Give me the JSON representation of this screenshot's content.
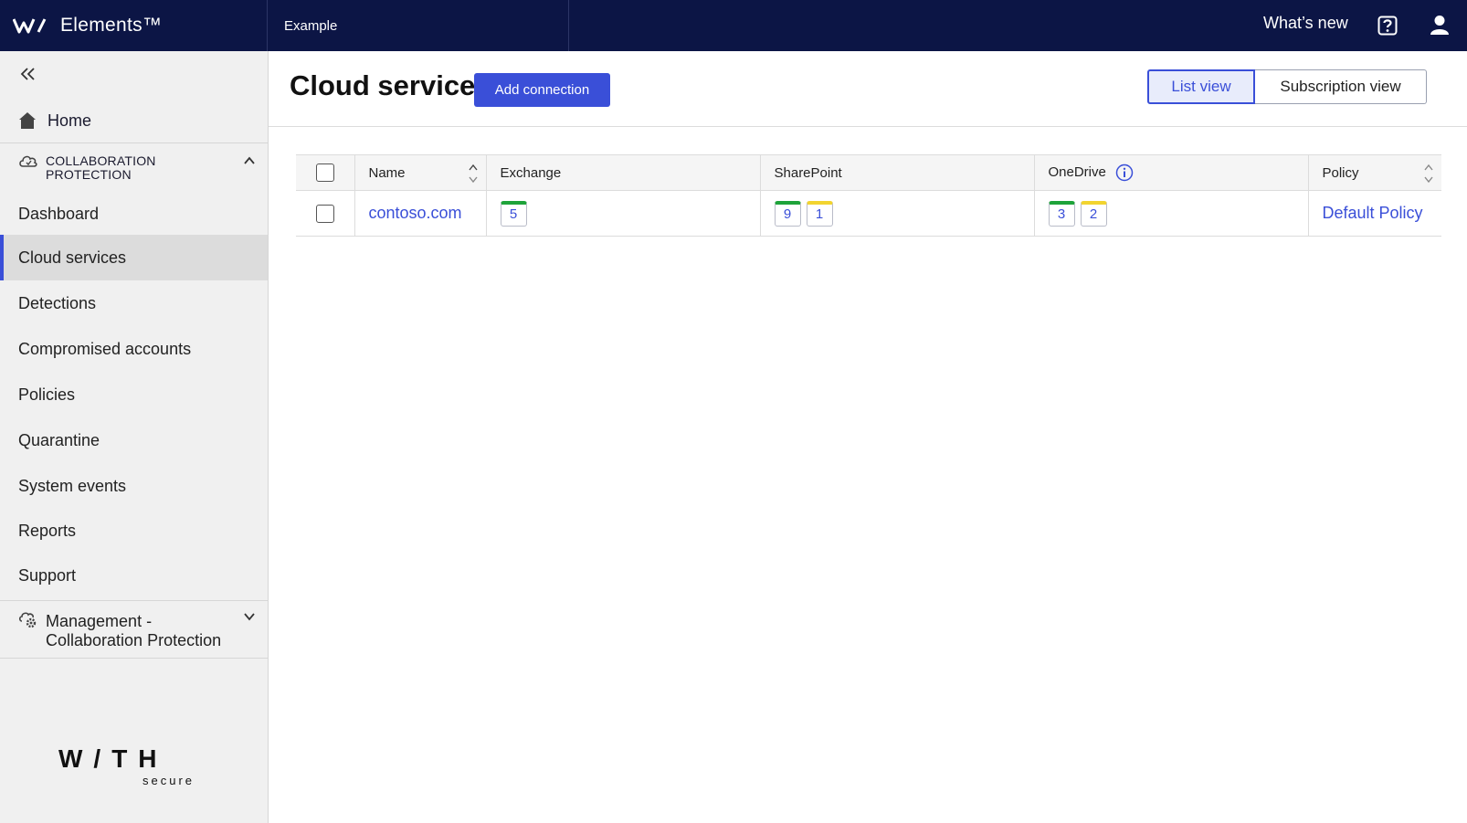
{
  "topbar": {
    "brand": "Elements™",
    "tenant": "Example",
    "whats_new": "What’s new"
  },
  "sidebar": {
    "home": "Home",
    "section": "COLLABORATION PROTECTION",
    "items": [
      {
        "label": "Dashboard"
      },
      {
        "label": "Cloud services",
        "active": true
      },
      {
        "label": "Detections"
      },
      {
        "label": "Compromised accounts"
      },
      {
        "label": "Policies"
      },
      {
        "label": "Quarantine"
      },
      {
        "label": "System events"
      },
      {
        "label": "Reports"
      },
      {
        "label": "Support"
      }
    ],
    "management": "Management - Collaboration Protection",
    "footer_logo_word": "W/TH",
    "footer_logo_sub": "secure"
  },
  "main": {
    "title": "Cloud services",
    "add_button": "Add connection",
    "views": {
      "list": "List view",
      "subscription": "Subscription view"
    },
    "table": {
      "columns": [
        "Name",
        "Exchange",
        "SharePoint",
        "OneDrive",
        "Policy"
      ],
      "rows": [
        {
          "name": "contoso.com",
          "exchange": [
            {
              "value": "5",
              "status": "green"
            }
          ],
          "sharepoint": [
            {
              "value": "9",
              "status": "green"
            },
            {
              "value": "1",
              "status": "yellow"
            }
          ],
          "onedrive": [
            {
              "value": "3",
              "status": "green"
            },
            {
              "value": "2",
              "status": "yellow"
            }
          ],
          "policy": "Default Policy"
        }
      ]
    }
  },
  "colors": {
    "topbar": "#0c1545",
    "accent": "#3a4fd8",
    "ok": "#1ea33a",
    "warning": "#f2d430"
  }
}
